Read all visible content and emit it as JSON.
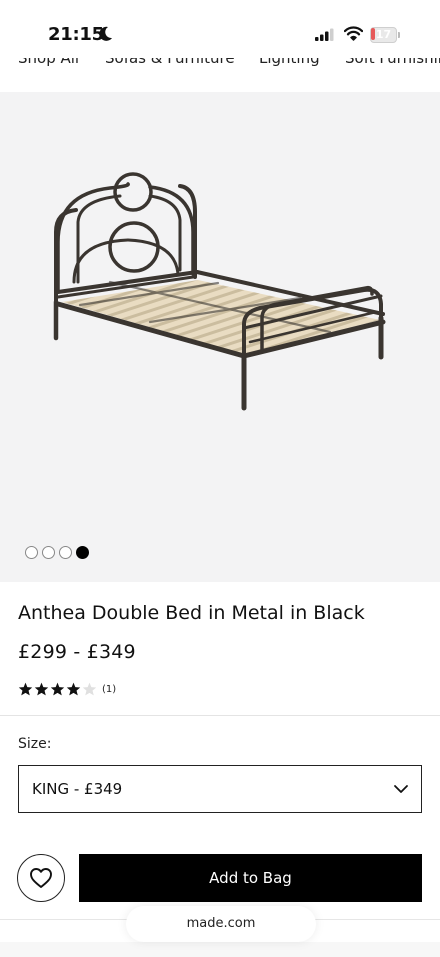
{
  "status_bar": {
    "time": "21:15",
    "battery_level": "17"
  },
  "nav": {
    "items": [
      {
        "label": "Shop All"
      },
      {
        "label": "Sofas & Furniture"
      },
      {
        "label": "Lighting"
      },
      {
        "label": "Soft Furnishings"
      }
    ]
  },
  "gallery": {
    "image_count": 4,
    "active_index": 3
  },
  "product": {
    "title": "Anthea Double Bed in Metal in Black",
    "price": "£299 - £349",
    "rating": 4,
    "rating_max": 5,
    "review_count": "(1)"
  },
  "size": {
    "label": "Size:",
    "selected": "KING - £349"
  },
  "actions": {
    "add_to_bag": "Add to Bag"
  },
  "browser": {
    "url": "made.com"
  },
  "colors": {
    "primary_button": "#000000",
    "gallery_bg": "#f3f3f4",
    "battery_low": "#e65a5a"
  }
}
